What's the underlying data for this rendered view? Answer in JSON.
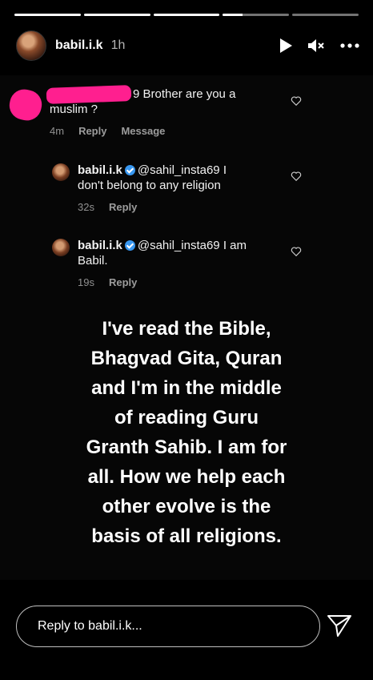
{
  "story": {
    "progress": [
      1,
      1,
      1,
      0.3,
      0
    ]
  },
  "header": {
    "username": "babil.i.k",
    "time": "1h",
    "icons": [
      "play-icon",
      "mute-icon",
      "more-icon"
    ]
  },
  "comments": [
    {
      "author_redacted": true,
      "author_tail": "9",
      "text_line1": "Brother are you a",
      "text_line2": "muslim ?",
      "time": "4m",
      "reply_label": "Reply",
      "message_label": "Message"
    },
    {
      "author": "babil.i.k",
      "mention": "@sahil_insta69",
      "text_line1_tail": "I",
      "text_line2": "don't belong to any religion",
      "time": "32s",
      "reply_label": "Reply"
    },
    {
      "author": "babil.i.k",
      "mention": "@sahil_insta69",
      "text_line1_tail": "I am",
      "text_line2": "Babil.",
      "time": "19s",
      "reply_label": "Reply"
    }
  ],
  "quote_lines": [
    "I've read the Bible,",
    "Bhagvad Gita, Quran",
    "and I'm in the middle",
    "of reading Guru",
    "Granth Sahib. I am for",
    "all. How we help each",
    "other evolve is the",
    "basis of all religions."
  ],
  "reply_bar": {
    "placeholder": "Reply to babil.i.k..."
  }
}
